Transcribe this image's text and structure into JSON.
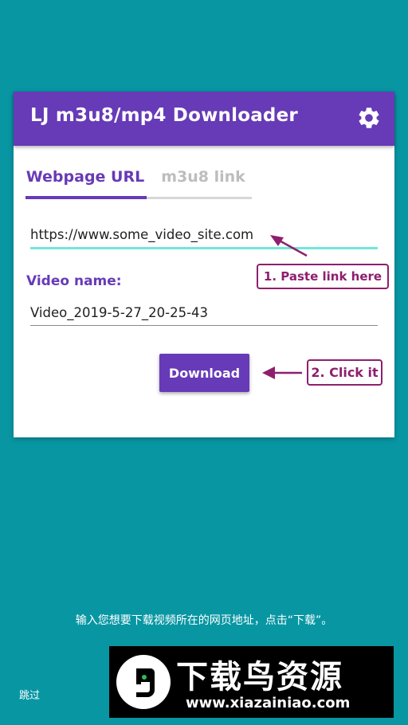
{
  "app": {
    "title": "LJ m3u8/mp4 Downloader"
  },
  "tabs": [
    {
      "label": "Webpage URL"
    },
    {
      "label": "m3u8 link"
    }
  ],
  "url_field": {
    "value": "https://www.some_video_site.com"
  },
  "video_name": {
    "label": "Video name:",
    "value": "Video_2019-5-27_20-25-43"
  },
  "download_button": {
    "label": "Download"
  },
  "callouts": {
    "step1": "1. Paste link here",
    "step2": "2. Click it"
  },
  "hint": "输入您想要下载视频所在的网页地址，点击“下载”。",
  "skip_label": "跳过",
  "watermark": {
    "name": "下载鸟资源",
    "url": "www.xiazainiao.com"
  },
  "colors": {
    "accent": "#673AB7",
    "background": "#0896A3",
    "callout": "#8E1F6E",
    "url_underline": "#6FE7DC"
  },
  "icons": {
    "settings": "gear-icon",
    "watermark": "bird-logo-icon"
  }
}
